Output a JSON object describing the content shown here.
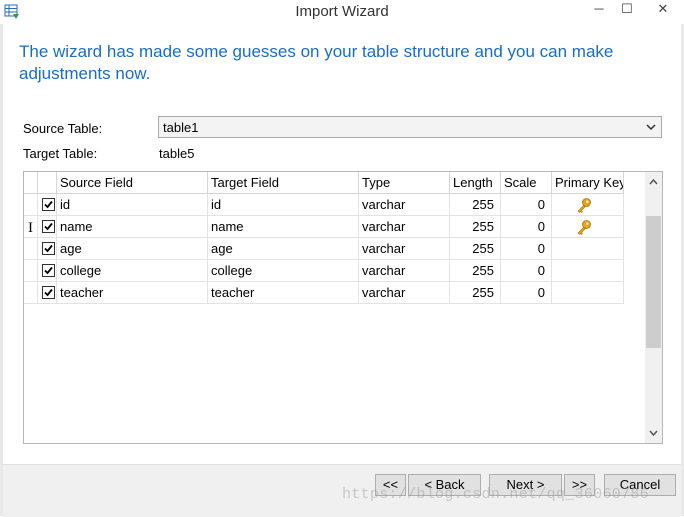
{
  "window": {
    "title": "Import Wizard",
    "minimize": "─",
    "maximize": "☐",
    "close": "✕",
    "app_icon": "table-import-icon"
  },
  "heading": "The wizard has made some guesses on your table structure and you can make adjustments now.",
  "source_table": {
    "label": "Source Table:",
    "value": "table1"
  },
  "target_table": {
    "label": "Target Table:",
    "value": "table5"
  },
  "grid": {
    "columns": [
      "Source Field",
      "Target Field",
      "Type",
      "Length",
      "Scale",
      "Primary Key"
    ],
    "rows": [
      {
        "checked": true,
        "source": "id",
        "target": "id",
        "type": "varchar",
        "length": "255",
        "scale": "0",
        "primary_key": true
      },
      {
        "checked": true,
        "source": "name",
        "target": "name",
        "type": "varchar",
        "length": "255",
        "scale": "0",
        "primary_key": true
      },
      {
        "checked": true,
        "source": "age",
        "target": "age",
        "type": "varchar",
        "length": "255",
        "scale": "0",
        "primary_key": false
      },
      {
        "checked": true,
        "source": "college",
        "target": "college",
        "type": "varchar",
        "length": "255",
        "scale": "0",
        "primary_key": false
      },
      {
        "checked": true,
        "source": "teacher",
        "target": "teacher",
        "type": "varchar",
        "length": "255",
        "scale": "0",
        "primary_key": false
      }
    ]
  },
  "buttons": {
    "first": "<<",
    "back": "< Back",
    "next": "Next >",
    "last": ">>",
    "cancel": "Cancel"
  },
  "watermark": "https://blog.csdn.net/qq_36060786",
  "colors": {
    "heading": "#1a6ec2",
    "key": "#e0a81c"
  }
}
